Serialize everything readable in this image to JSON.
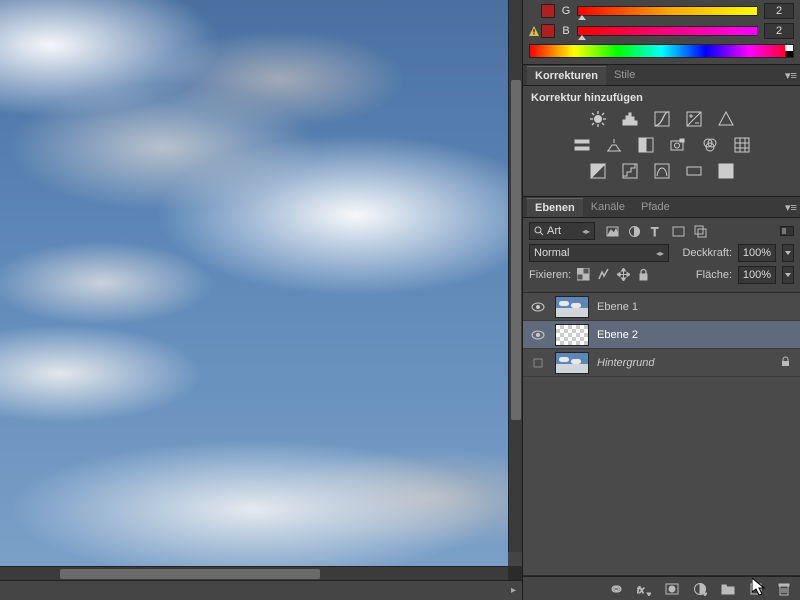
{
  "channels": {
    "g": {
      "label": "G",
      "value": "2",
      "swatch": "#b02020"
    },
    "b": {
      "label": "B",
      "value": "2",
      "swatch": "#b02020"
    }
  },
  "panels": {
    "adjustments": {
      "tab1": "Korrekturen",
      "tab2": "Stile",
      "title": "Korrektur hinzufügen"
    },
    "layers": {
      "tab1": "Ebenen",
      "tab2": "Kanäle",
      "tab3": "Pfade"
    }
  },
  "layers": {
    "filter_label": "Art",
    "blend_mode": "Normal",
    "opacity_label": "Deckkraft:",
    "opacity_value": "100%",
    "fill_label": "Fläche:",
    "fill_value": "100%",
    "lock_label": "Fixieren:",
    "items": [
      {
        "name": "Ebene 1",
        "visible": true,
        "thumb": "sky",
        "selected": false,
        "locked": false,
        "italic": false
      },
      {
        "name": "Ebene 2",
        "visible": true,
        "thumb": "transparent",
        "selected": true,
        "locked": false,
        "italic": false
      },
      {
        "name": "Hintergrund",
        "visible": false,
        "thumb": "sky",
        "selected": false,
        "locked": true,
        "italic": true
      }
    ]
  },
  "status_arrow": "▸"
}
